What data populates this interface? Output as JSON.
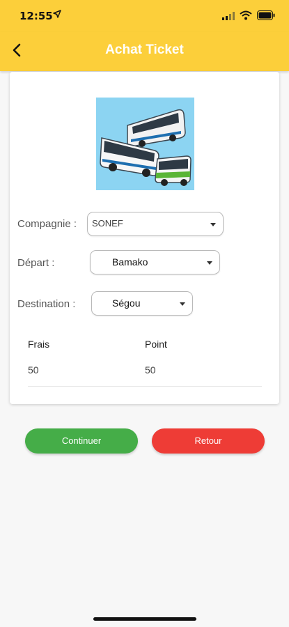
{
  "status_bar": {
    "time": "12:55"
  },
  "header": {
    "title": "Achat Ticket"
  },
  "form": {
    "compagnie": {
      "label": "Compagnie :",
      "value": "SONEF"
    },
    "depart": {
      "label": "Départ :",
      "value": "Bamako"
    },
    "destination": {
      "label": "Destination :",
      "value": "Ségou"
    },
    "frais": {
      "label": "Frais",
      "value": "50"
    },
    "point": {
      "label": "Point",
      "value": "50"
    }
  },
  "buttons": {
    "continue_label": "Continuer",
    "back_label": "Retour"
  },
  "colors": {
    "accent": "#fccf3a",
    "continue": "#45ad48",
    "back": "#ee3c36"
  }
}
